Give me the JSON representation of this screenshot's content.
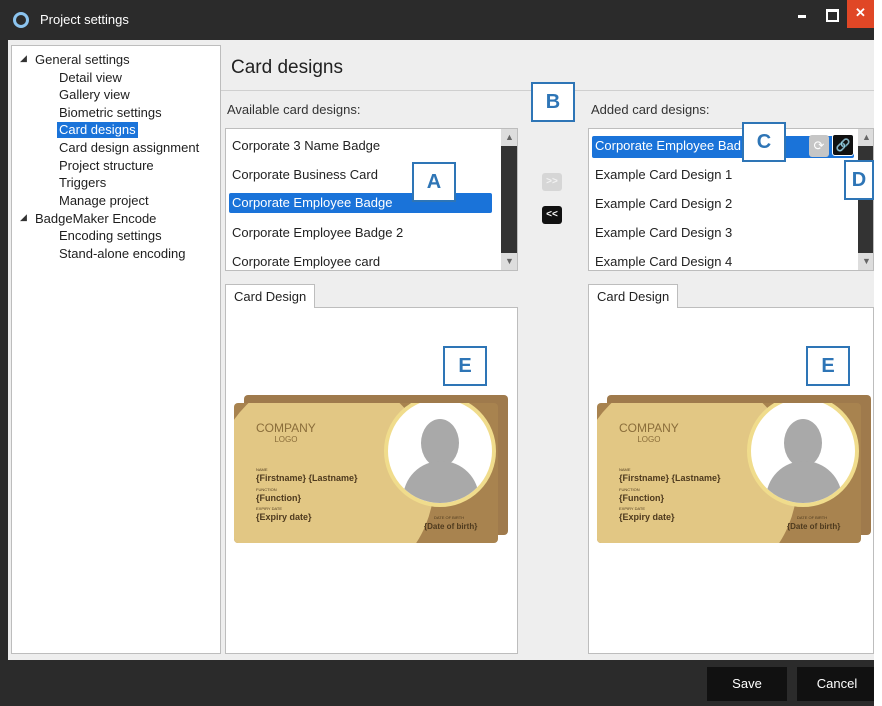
{
  "window": {
    "title": "Project settings",
    "close_glyph": "✕",
    "icon": "app-ring-icon"
  },
  "tree": {
    "groups": [
      {
        "label": "General settings",
        "children": [
          "Detail view",
          "Gallery view",
          "Biometric settings",
          "Card designs",
          "Card design assignment",
          "Project structure",
          "Triggers",
          "Manage project"
        ]
      },
      {
        "label": "BadgeMaker Encode",
        "children": [
          "Encoding settings",
          "Stand-alone encoding"
        ]
      }
    ],
    "selected": "Card designs"
  },
  "main": {
    "title": "Card designs",
    "available_label": "Available card designs:",
    "added_label": "Added card designs:",
    "available_items": [
      "Corporate 3 Name Badge",
      "Corporate Business Card",
      "Corporate Employee Badge",
      "Corporate Employee Badge 2",
      "Corporate Employee card"
    ],
    "available_selected": "Corporate Employee Badge",
    "added_items": [
      "Corporate Employee Badge",
      "Example Card Design 1",
      "Example Card Design 2",
      "Example Card Design 3",
      "Example Card Design 4"
    ],
    "added_selected_display": "Corporate Employee Bad",
    "add_button": ">>",
    "remove_button": "<<",
    "tab_label": "Card Design",
    "row_icons": [
      "refresh-icon",
      "link-icon"
    ]
  },
  "callouts": {
    "a": "A",
    "b": "B",
    "c": "C",
    "d": "D",
    "e": "E"
  },
  "badge": {
    "logo_line1": "COMPANY",
    "logo_line2": "LOGO",
    "name_caption": "NAME",
    "name_value": "{Firstname} {Lastname}",
    "function_caption": "FUNCTION",
    "function_value": "{Function}",
    "expiry_caption": "EXPIRY DATE",
    "expiry_value": "{Expiry date}",
    "dob_caption": "DATE OF BIRTH",
    "dob_value": "{Date of birth}"
  },
  "footer": {
    "save_label": "Save",
    "cancel_label": "Cancel"
  },
  "colors": {
    "selection": "#1a73d9",
    "callout_border": "#2e75b6",
    "close_button": "#e04726",
    "chrome": "#2b2b2b"
  }
}
